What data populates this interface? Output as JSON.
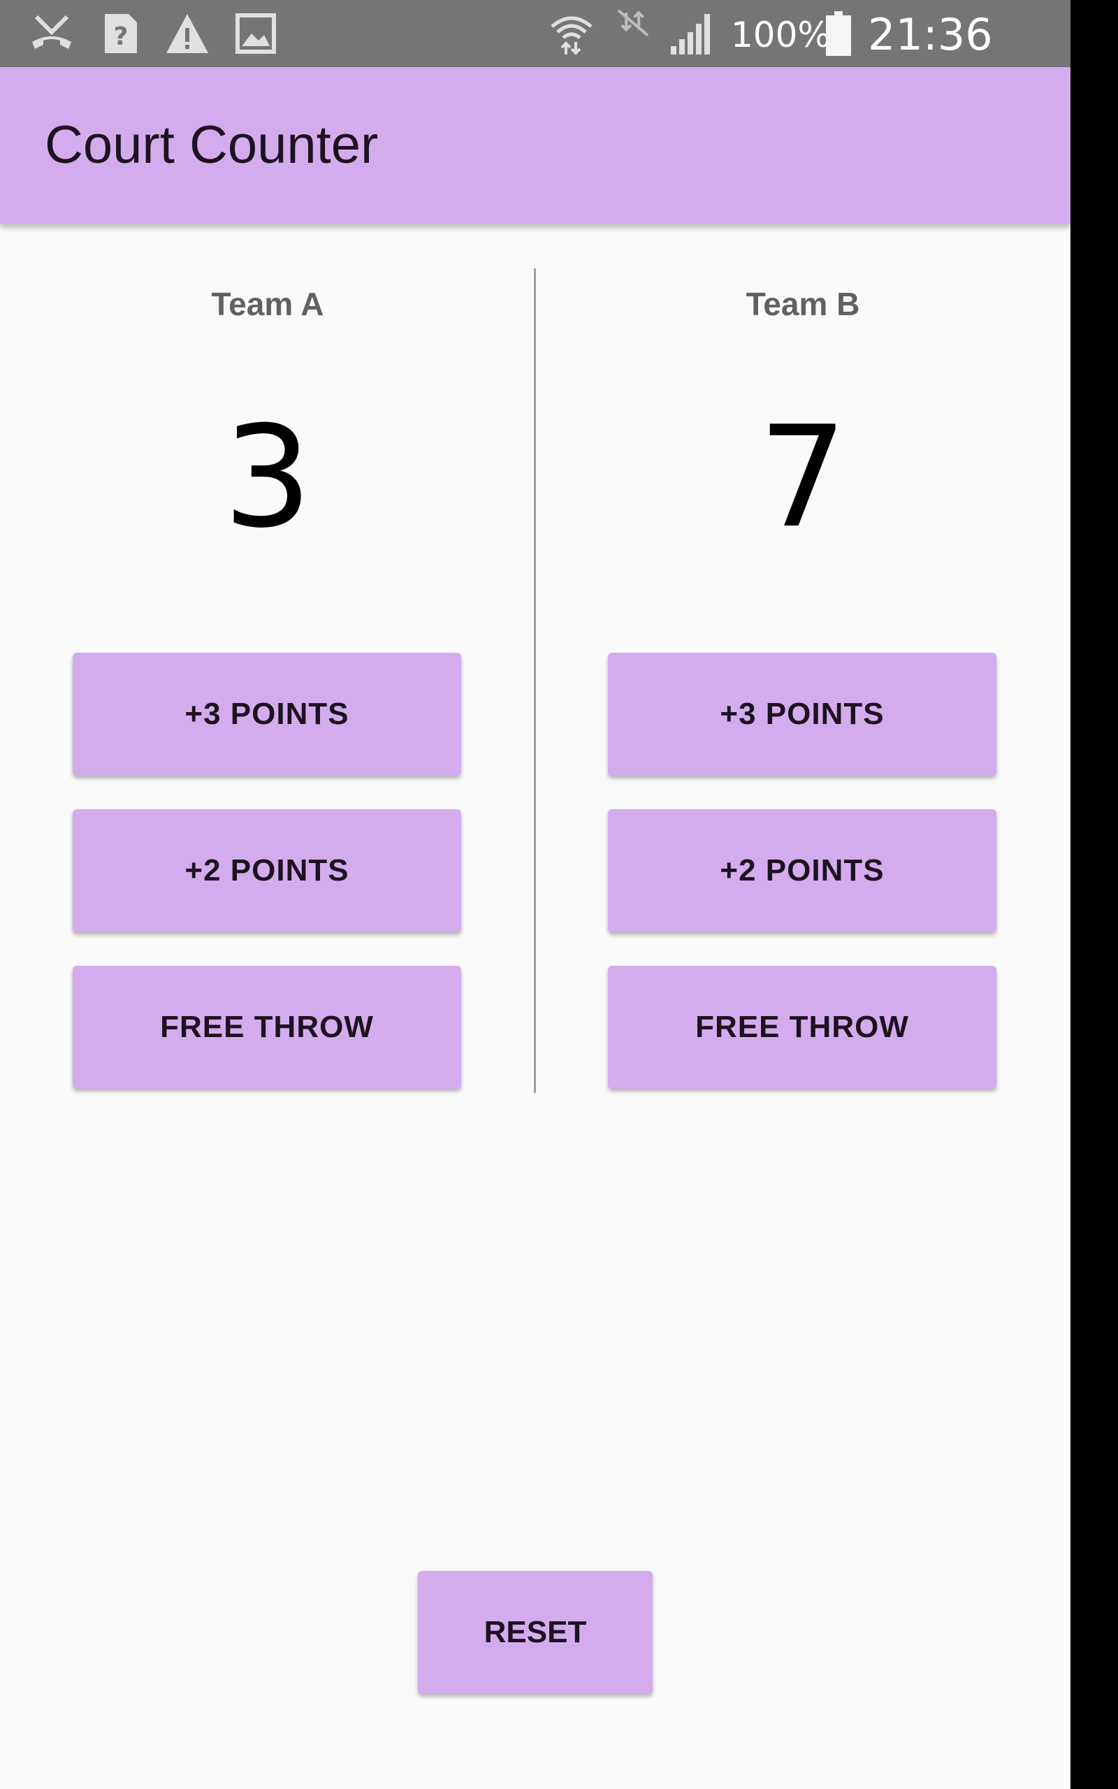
{
  "status_bar": {
    "battery_percent": "100%",
    "clock": "21:36",
    "icons": [
      "missed-call-icon",
      "unknown-file-icon",
      "warning-icon",
      "image-icon",
      "wifi-icon",
      "no-mobile-data-icon",
      "cell-signal-icon",
      "battery-icon"
    ]
  },
  "app": {
    "title": "Court Counter"
  },
  "team_a": {
    "name": "Team A",
    "score": "3",
    "buttons": {
      "three": "+3 POINTS",
      "two": "+2 POINTS",
      "free_throw": "FREE THROW"
    }
  },
  "team_b": {
    "name": "Team B",
    "score": "7",
    "buttons": {
      "three": "+3 POINTS",
      "two": "+2 POINTS",
      "free_throw": "FREE THROW"
    }
  },
  "reset_label": "RESET",
  "colors": {
    "accent": "#d4acee",
    "status_bar": "#757575",
    "background": "#fafafa"
  }
}
